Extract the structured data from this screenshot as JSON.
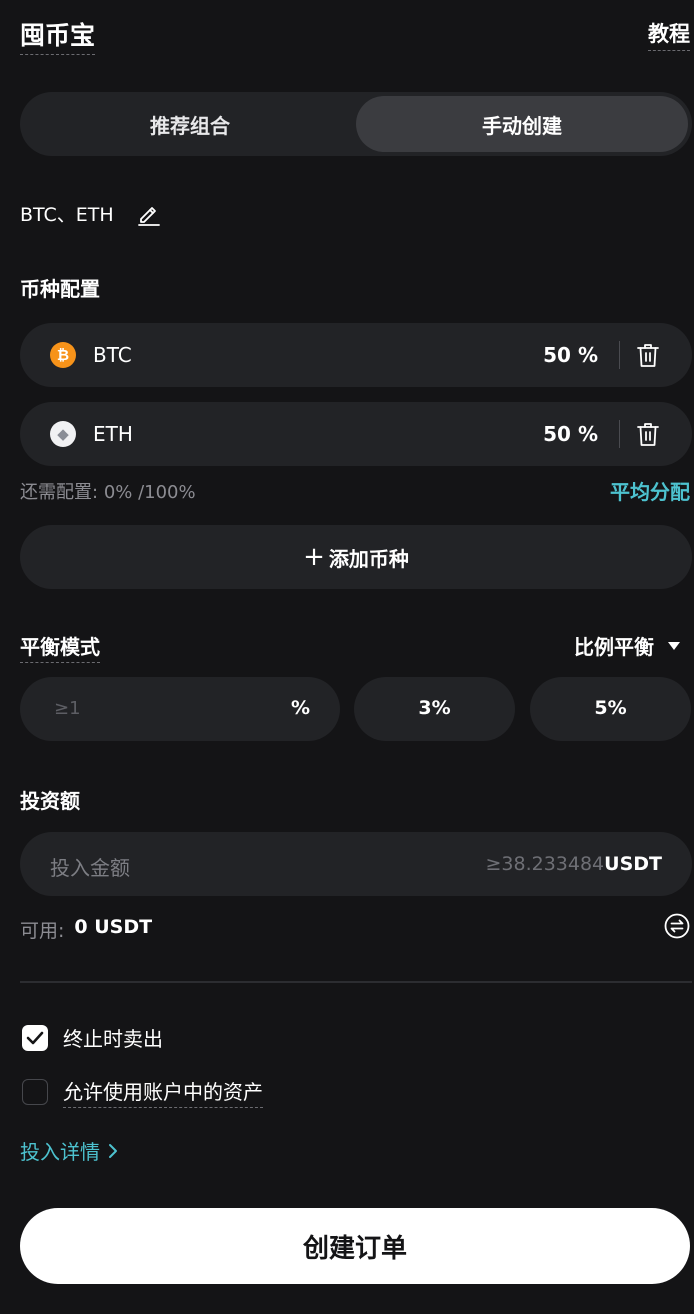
{
  "header": {
    "title": "囤币宝",
    "tutorial": "教程"
  },
  "tabs": [
    {
      "label": "推荐组合",
      "active": false
    },
    {
      "label": "手动创建",
      "active": true
    }
  ],
  "portfolio": {
    "name": "BTC、ETH"
  },
  "allocation": {
    "heading": "币种配置",
    "coins": [
      {
        "symbol": "BTC",
        "icon": "bitcoin-icon",
        "glyph": "₿",
        "percent": "50",
        "unit": "%"
      },
      {
        "symbol": "ETH",
        "icon": "ethereum-icon",
        "glyph": "◆",
        "percent": "50",
        "unit": "%"
      }
    ],
    "remaining_label": "还需配置:",
    "remaining_value": "0% /100%",
    "equal_split": "平均分配",
    "add_coin": "添加币种",
    "add_plus": "+"
  },
  "balance": {
    "heading": "平衡模式",
    "mode": "比例平衡",
    "custom_placeholder": "≥1",
    "custom_unit": "%",
    "presets": [
      "3%",
      "5%"
    ]
  },
  "investment": {
    "heading": "投资额",
    "placeholder": "投入金额",
    "min": "≥38.233484",
    "unit": "USDT",
    "available_label": "可用:",
    "available_value": "0 USDT"
  },
  "options": [
    {
      "label": "终止时卖出",
      "checked": true
    },
    {
      "label": "允许使用账户中的资产",
      "checked": false
    }
  ],
  "details_link": "投入详情",
  "submit": "创建订单",
  "colors": {
    "background": "#141416",
    "surface": "#222326",
    "accent": "#4dc2cf",
    "btc": "#f7931a"
  }
}
